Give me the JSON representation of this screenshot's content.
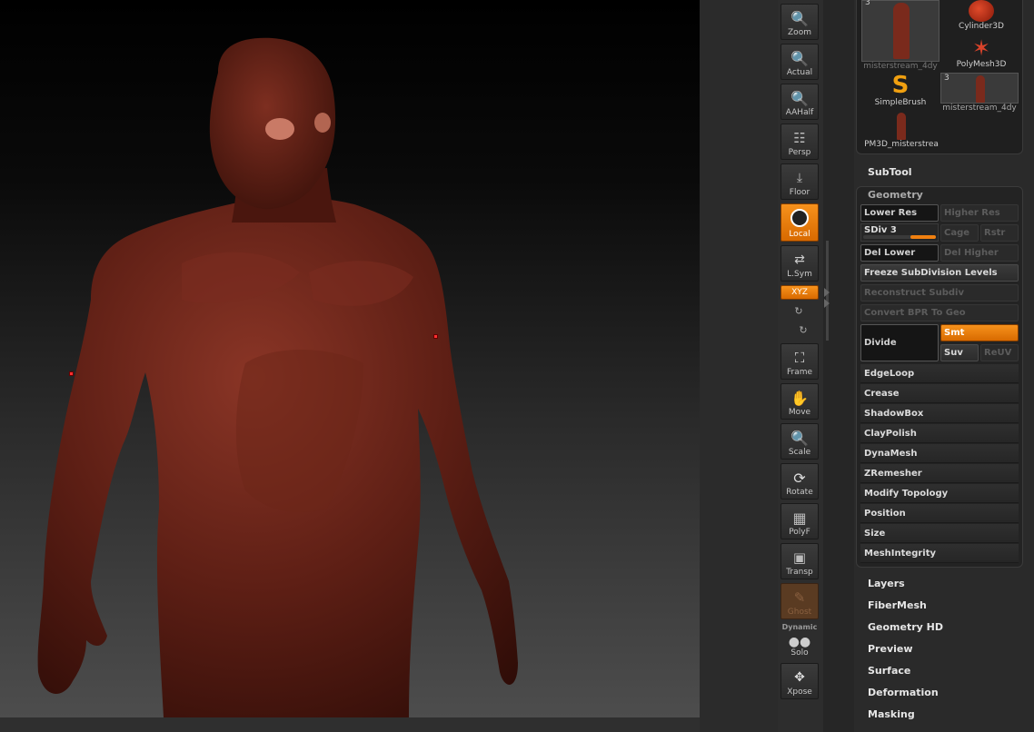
{
  "shelf": {
    "zoom": "Zoom",
    "actual": "Actual",
    "aahalf": "AAHalf",
    "persp": "Persp",
    "floor": "Floor",
    "local": "Local",
    "lsym": "L.Sym",
    "xyz": "XYZ",
    "frame": "Frame",
    "move": "Move",
    "scale": "Scale",
    "rotate": "Rotate",
    "polyf": "PolyF",
    "transp": "Transp",
    "ghost": "Ghost",
    "dynamic": "Dynamic",
    "solo": "Solo",
    "xpose": "Xpose"
  },
  "tools": {
    "items": [
      {
        "label": "misterstream_4dy",
        "count": "3"
      },
      {
        "label": "Cylinder3D"
      },
      {
        "label": "PolyMesh3D"
      },
      {
        "label": "SimpleBrush"
      },
      {
        "label": "misterstream_4dy",
        "count": "3"
      },
      {
        "label": "PM3D_misterstrea"
      }
    ]
  },
  "subtool": "SubTool",
  "geometry": {
    "title": "Geometry",
    "lower_res": "Lower Res",
    "higher_res": "Higher Res",
    "sdiv": "SDiv 3",
    "sdiv_level": 1.0,
    "cage": "Cage",
    "rstr": "Rstr",
    "del_lower": "Del Lower",
    "del_higher": "Del Higher",
    "freeze": "Freeze SubDivision Levels",
    "reconstruct": "Reconstruct Subdiv",
    "convert": "Convert BPR To Geo",
    "divide": "Divide",
    "smt": "Smt",
    "suv": "Suv",
    "reuv": "ReUV",
    "rows": [
      "EdgeLoop",
      "Crease",
      "ShadowBox",
      "ClayPolish",
      "DynaMesh",
      "ZRemesher",
      "Modify Topology",
      "Position",
      "Size",
      "MeshIntegrity"
    ]
  },
  "sections": [
    "Layers",
    "FiberMesh",
    "Geometry HD",
    "Preview",
    "Surface",
    "Deformation",
    "Masking"
  ],
  "colors": {
    "accent": "#f08010",
    "model": "#5a1a12"
  }
}
